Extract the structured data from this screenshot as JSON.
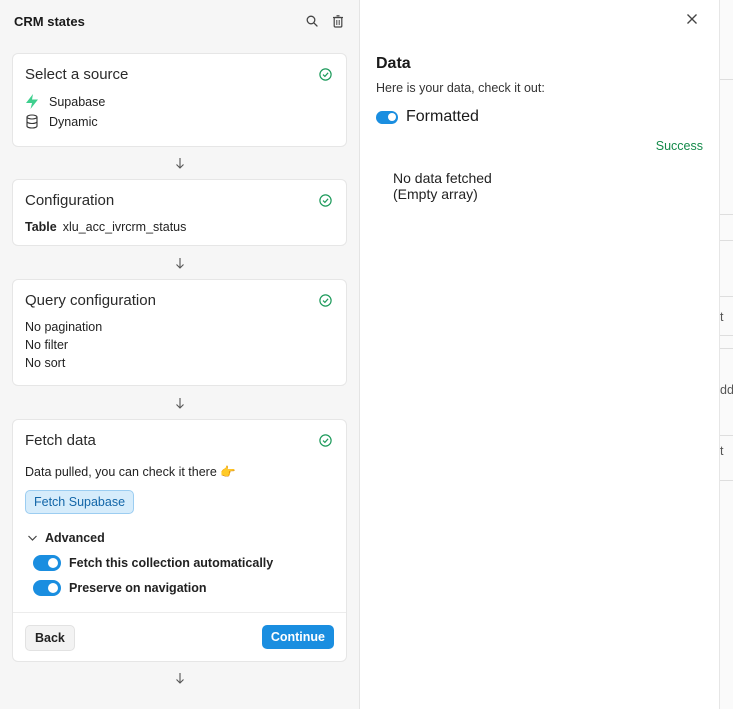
{
  "left": {
    "title": "CRM states",
    "icons": {
      "search": "search-icon",
      "delete": "trash-icon"
    }
  },
  "cards": {
    "source": {
      "title": "Select a source",
      "items": [
        {
          "icon": "supabase-bolt-icon",
          "label": "Supabase"
        },
        {
          "icon": "database-icon",
          "label": "Dynamic"
        }
      ]
    },
    "configuration": {
      "title": "Configuration",
      "table_key": "Table",
      "table_value": "xlu_acc_ivrcrm_status"
    },
    "query": {
      "title": "Query configuration",
      "lines": [
        "No pagination",
        "No filter",
        "No sort"
      ]
    },
    "fetch": {
      "title": "Fetch data",
      "message": "Data pulled, you can check it there 👉",
      "pill": "Fetch Supabase",
      "advanced_label": "Advanced",
      "toggles": [
        {
          "label": "Fetch this collection automatically",
          "on": true
        },
        {
          "label": "Preserve on navigation",
          "on": true
        }
      ],
      "back": "Back",
      "continue": "Continue"
    }
  },
  "right": {
    "title": "Data",
    "subtitle": "Here is your data, check it out:",
    "formatted_label": "Formatted",
    "formatted_on": true,
    "status": "Success",
    "nodata_line1": "No data fetched",
    "nodata_line2": "(Empty array)"
  },
  "sliver": {
    "frag1": "t",
    "frag2": "dd",
    "frag3": "t"
  },
  "colors": {
    "accent": "#1a8ee0",
    "success": "#148a4a",
    "check": "#1d9a5b",
    "supabase": "#3ecf8e"
  }
}
